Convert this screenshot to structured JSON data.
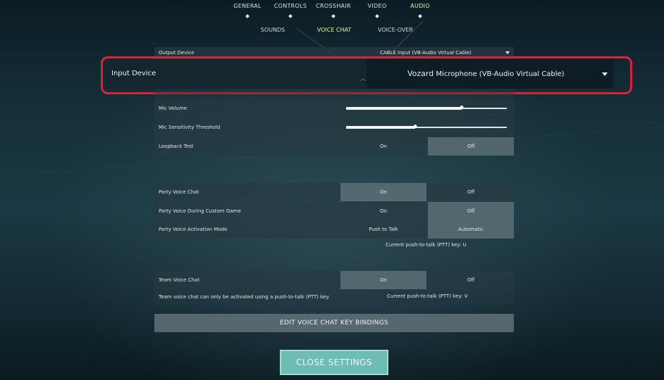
{
  "top_tabs": [
    {
      "label": "GENERAL",
      "active": false
    },
    {
      "label": "CONTROLS",
      "active": false
    },
    {
      "label": "CROSSHAIR",
      "active": false
    },
    {
      "label": "VIDEO",
      "active": false
    },
    {
      "label": "AUDIO",
      "active": true
    }
  ],
  "sub_tabs": [
    {
      "label": "SOUNDS",
      "active": false
    },
    {
      "label": "VOICE CHAT",
      "active": true
    },
    {
      "label": "VOICE-OVER",
      "active": false
    }
  ],
  "output_device": {
    "label": "Output Device",
    "value": "CABLE Input (VB-Audio Virtual Cable)"
  },
  "input_device": {
    "label": "Input Device",
    "value_prefix": "Vozard",
    "value": "Microphone (VB-Audio Virtual Cable)"
  },
  "mic_volume": {
    "label": "Mic Volume",
    "level": 0.72
  },
  "mic_sensitivity": {
    "label": "Mic Sensitivity Threshold",
    "level": 0.43
  },
  "loopback_test": {
    "label": "Loopback Test",
    "options": [
      "On",
      "Off"
    ],
    "selected": "Off"
  },
  "party_voice_chat": {
    "label": "Party Voice Chat",
    "options": [
      "On",
      "Off"
    ],
    "selected": "On"
  },
  "party_voice_custom": {
    "label": "Party Voice During Custom Game",
    "options": [
      "On",
      "Off"
    ],
    "selected": "Off"
  },
  "party_voice_mode": {
    "label": "Party Voice Activation Mode",
    "options": [
      "Push to Talk",
      "Automatic"
    ],
    "selected": "Automatic"
  },
  "party_ptt_key": "Current push-to-talk (PTT) key: U",
  "team_voice_chat": {
    "label": "Team Voice Chat",
    "options": [
      "On",
      "Off"
    ],
    "selected": "On"
  },
  "team_note": "Team voice chat can only be activated using a push-to-talk (PTT) key.",
  "team_ptt_key": "Current push-to-talk (PTT) key: V",
  "edit_bindings_label": "EDIT VOICE CHAT KEY BINDINGS",
  "close_settings_label": "CLOSE SETTINGS",
  "colors": {
    "active_tab": "#e8f3a8",
    "close_button": "#6fbcb5",
    "highlight": "#d8233f"
  }
}
